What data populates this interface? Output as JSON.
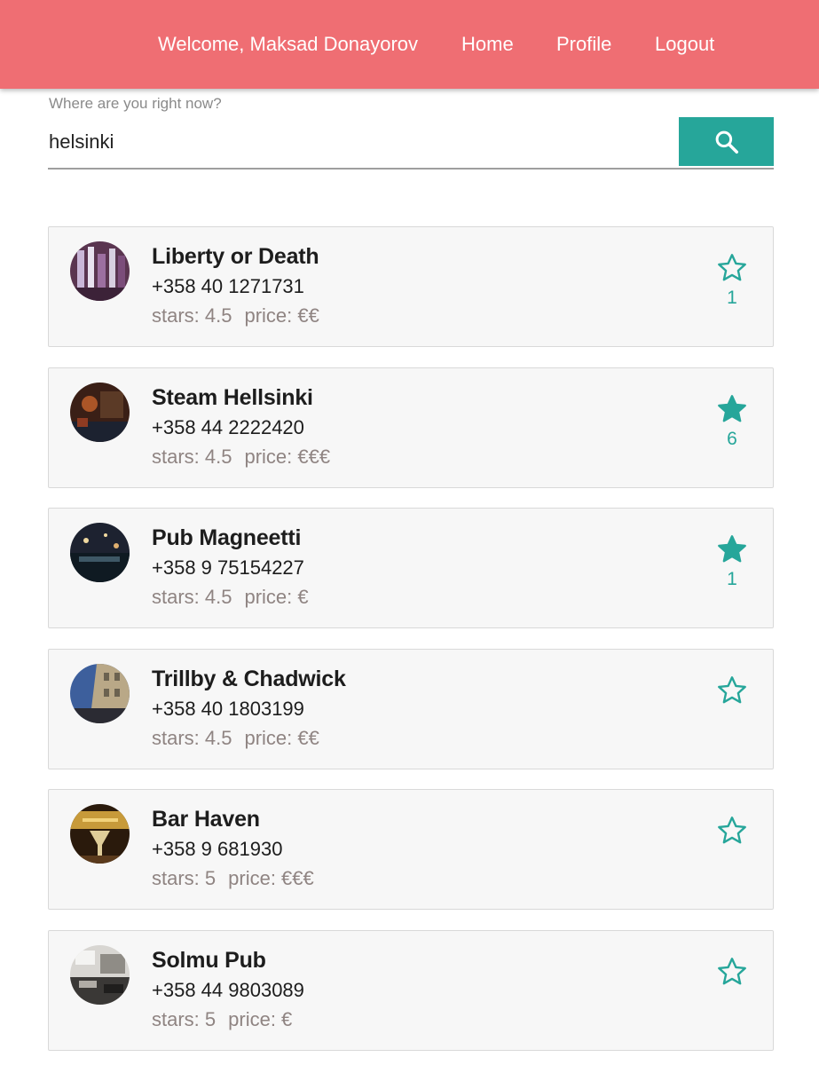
{
  "header": {
    "welcome": "Welcome,  Maksad Donayorov",
    "nav": {
      "home": "Home",
      "profile": "Profile",
      "logout": "Logout"
    },
    "background_color": "#ef6e73"
  },
  "search": {
    "label": "Where are you right now?",
    "value": "helsinki",
    "button_icon": "search-icon",
    "accent_color": "#26a69a"
  },
  "venues": [
    {
      "name": "Liberty or Death",
      "phone": "+358 40 1271731",
      "stars": "stars: 4.5",
      "price": "price: €€",
      "favorited": false,
      "count": "1",
      "photo": "bottles-bar-photo"
    },
    {
      "name": "Steam Hellsinki",
      "phone": "+358 44 2222420",
      "stars": "stars: 4.5",
      "price": "price: €€€",
      "favorited": true,
      "count": "6",
      "photo": "dim-bar-interior-photo"
    },
    {
      "name": "Pub Magneetti",
      "phone": "+358 9 75154227",
      "stars": "stars: 4.5",
      "price": "price: €",
      "favorited": true,
      "count": "1",
      "photo": "night-pub-photo"
    },
    {
      "name": "Trillby & Chadwick",
      "phone": "+358 40 1803199",
      "stars": "stars: 4.5",
      "price": "price: €€",
      "favorited": false,
      "count": "",
      "photo": "street-facade-photo"
    },
    {
      "name": "Bar Haven",
      "phone": "+358 9 681930",
      "stars": "stars: 5",
      "price": "price: €€€",
      "favorited": false,
      "count": "",
      "photo": "cocktail-glass-photo"
    },
    {
      "name": "Solmu Pub",
      "phone": "+358 44 9803089",
      "stars": "stars: 5",
      "price": "price: €",
      "favorited": false,
      "count": "",
      "photo": "pub-interior-photo"
    }
  ]
}
